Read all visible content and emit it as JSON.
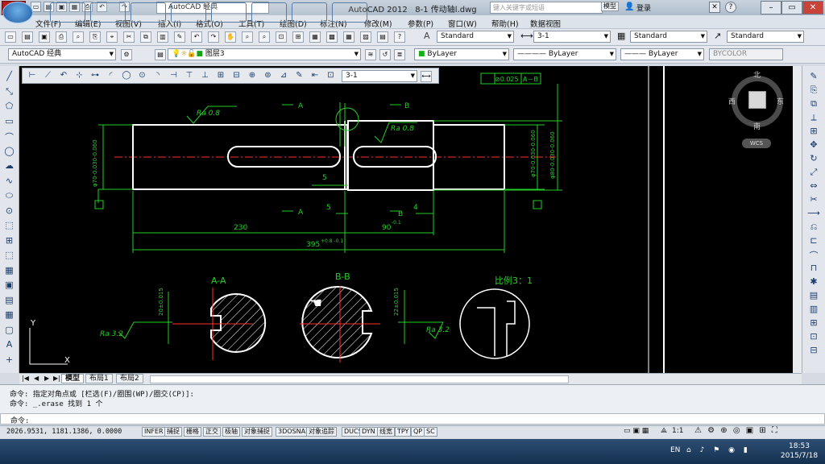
{
  "titlebar": {
    "app_name": "AutoCAD 2012",
    "file_name": "8-1 传动轴l.dwg",
    "workspace": "AutoCAD 经典",
    "search_placeholder": "键入关键字或短语",
    "login": "登录",
    "help": "?"
  },
  "menu": [
    "文件(F)",
    "编辑(E)",
    "视图(V)",
    "插入(I)",
    "格式(O)",
    "工具(T)",
    "绘图(D)",
    "标注(N)",
    "修改(M)",
    "参数(P)",
    "窗口(W)",
    "帮助(H)",
    "数据视图"
  ],
  "styles": {
    "text_style": "Standard",
    "dim_style": "3-1",
    "table_style": "Standard",
    "mleader_style": "Standard"
  },
  "layers": {
    "workspace": "AutoCAD 经典",
    "current_layer": "图层3",
    "color": "ByLayer",
    "linetype": "ByLayer",
    "lineweight": "ByLayer",
    "plotstyle": "BYCOLOR"
  },
  "dim_toolbar": {
    "dim_style": "3-1"
  },
  "viewcube": {
    "north": "北",
    "south": "南",
    "east": "东",
    "west": "西",
    "wcs": "WCS"
  },
  "drawing": {
    "section_a": "A",
    "section_b": "B",
    "ra08": "Ra 0.8",
    "ra32": "Ra 3.2",
    "geo_tol": "⊘0.025",
    "datum": "A－B",
    "dim_230": "230",
    "dim_5": "5",
    "dim_5b": "5",
    "dim_4": "4",
    "dim_90": "90",
    "dim_395": "395",
    "dim_90_tol": "-0.1",
    "dim_395_tol": "+0.8 -0.1",
    "dia_70": "φ70-0.030-0.060",
    "dia_80": "φ80-0.030-0.060",
    "dia_70r": "φ70-0.030-0.060",
    "title_aa": "A-A",
    "title_bb": "B-B",
    "title_scale": "比例3：1",
    "sec_dim_a": "20±0.015",
    "sec_dim_b": "22±0.015",
    "axis_y": "Y",
    "axis_x": "X"
  },
  "tabs": [
    "模型",
    "布局1",
    "布局2"
  ],
  "command": {
    "line1": "命令: 指定对角点或 [栏选(F)/圈围(WP)/圈交(CP)]:",
    "line2": "命令: _.erase 找到 1 个",
    "prompt": "命令:"
  },
  "status": {
    "coords": "2026.9531, 1181.1386, 0.0000",
    "buttons": [
      "INFER",
      "捕捉",
      "栅格",
      "正交",
      "极轴",
      "对象捕捉",
      "3DOSNAP",
      "对象追踪",
      "DUCS",
      "DYN",
      "线宽",
      "TPY",
      "QP",
      "SC"
    ],
    "model": "模型",
    "scale": "1:1"
  },
  "taskbar": {
    "time": "18:53",
    "date": "2015/7/18",
    "lang": "EN"
  }
}
